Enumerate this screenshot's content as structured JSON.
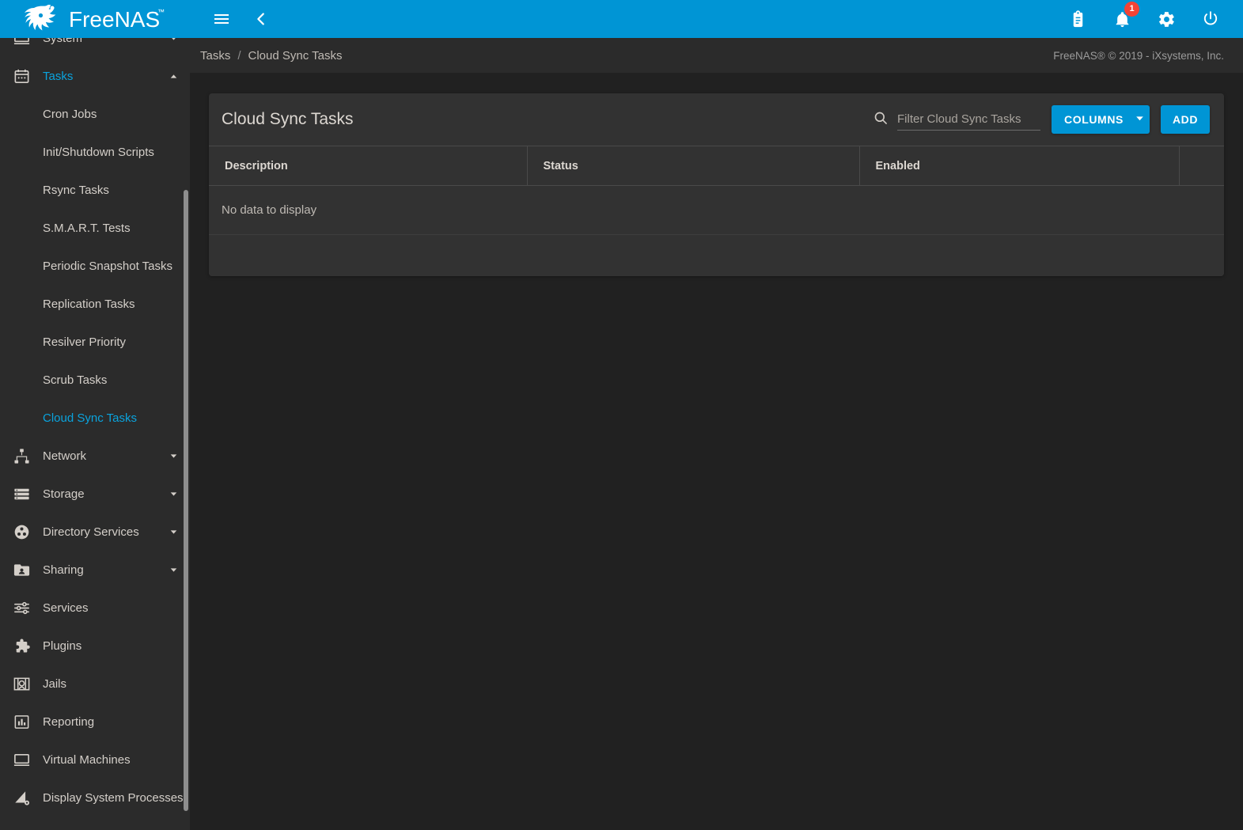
{
  "app": {
    "brand_name": "FreeNAS",
    "accent_color": "#0095d5",
    "badge_color": "#f44336",
    "active_color": "#0aa3dd",
    "sidebar_bg": "#2b2b2b",
    "page_bg": "#212121",
    "card_bg": "#323232"
  },
  "topbar": {
    "menu_icon": "hamburger-menu-icon",
    "collapse_icon": "chevron-left-icon",
    "actions": [
      {
        "name": "task-manager",
        "icon": "clipboard-icon",
        "badge": ""
      },
      {
        "name": "notifications",
        "icon": "bell-icon",
        "badge": "1"
      },
      {
        "name": "settings",
        "icon": "gear-icon",
        "badge": ""
      },
      {
        "name": "power",
        "icon": "power-icon",
        "badge": ""
      }
    ]
  },
  "sidebar": {
    "items": [
      {
        "label": "System",
        "icon": "monitor-icon",
        "expanded": false,
        "active": false
      },
      {
        "label": "Tasks",
        "icon": "calendar-icon",
        "expanded": true,
        "active": true
      },
      {
        "label": "Network",
        "icon": "sitemap-icon",
        "expanded": false,
        "active": false
      },
      {
        "label": "Storage",
        "icon": "storage-list-icon",
        "expanded": false,
        "active": false
      },
      {
        "label": "Directory Services",
        "icon": "directory-nodes-icon",
        "expanded": false,
        "active": false
      },
      {
        "label": "Sharing",
        "icon": "folder-shared-icon",
        "expanded": false,
        "active": false
      },
      {
        "label": "Services",
        "icon": "sliders-icon",
        "expanded": null,
        "active": false
      },
      {
        "label": "Plugins",
        "icon": "puzzle-piece-icon",
        "expanded": null,
        "active": false
      },
      {
        "label": "Jails",
        "icon": "jail-icon",
        "expanded": null,
        "active": false
      },
      {
        "label": "Reporting",
        "icon": "bar-chart-icon",
        "expanded": null,
        "active": false
      },
      {
        "label": "Virtual Machines",
        "icon": "laptop-icon",
        "expanded": null,
        "active": false
      },
      {
        "label": "Display System Processes",
        "icon": "processes-icon",
        "expanded": null,
        "active": false
      }
    ],
    "tasks_subitems": [
      {
        "label": "Cron Jobs",
        "active": false
      },
      {
        "label": "Init/Shutdown Scripts",
        "active": false
      },
      {
        "label": "Rsync Tasks",
        "active": false
      },
      {
        "label": "S.M.A.R.T. Tests",
        "active": false
      },
      {
        "label": "Periodic Snapshot Tasks",
        "active": false
      },
      {
        "label": "Replication Tasks",
        "active": false
      },
      {
        "label": "Resilver Priority",
        "active": false
      },
      {
        "label": "Scrub Tasks",
        "active": false
      },
      {
        "label": "Cloud Sync Tasks",
        "active": true
      }
    ]
  },
  "breadcrumb": {
    "parent": "Tasks",
    "separator": "/",
    "current": "Cloud Sync Tasks"
  },
  "footer": {
    "copyright": "FreeNAS® © 2019 - iXsystems, Inc."
  },
  "card": {
    "title": "Cloud Sync Tasks",
    "search": {
      "icon": "search-icon",
      "placeholder": "Filter Cloud Sync Tasks",
      "value": ""
    },
    "columns_button": {
      "label": "COLUMNS",
      "icon": "chevron-down-icon"
    },
    "add_button": {
      "label": "ADD"
    },
    "table": {
      "headers": [
        "Description",
        "Status",
        "Enabled",
        ""
      ],
      "rows": [],
      "empty_message": "No data to display"
    }
  }
}
